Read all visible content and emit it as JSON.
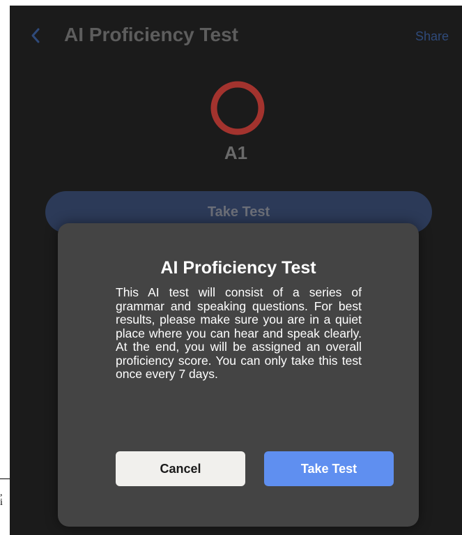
{
  "stray_doc": {
    "line1": ",",
    "line2": "i"
  },
  "header": {
    "back_icon": "chevron-left-icon",
    "title": "AI Proficiency Test",
    "share_label": "Share"
  },
  "level": {
    "ring_icon": "circle-ring-icon",
    "ring_color": "#a3332e",
    "value": "A1"
  },
  "main": {
    "take_test_label": "Take Test"
  },
  "modal": {
    "title": "AI Proficiency Test",
    "body": "This AI test will consist of a series of grammar and speaking questions. For best results, please make sure you are in a quiet place where you can hear and speak clearly. At the end, you will be assigned an overall proficiency score. You can only take this test once every 7 days.",
    "cancel_label": "Cancel",
    "take_test_label": "Take Test"
  },
  "colors": {
    "background": "#1b1b1b",
    "modal_background": "#444444",
    "accent": "#5f8ff0",
    "back_arrow": "#2f4a7a"
  }
}
